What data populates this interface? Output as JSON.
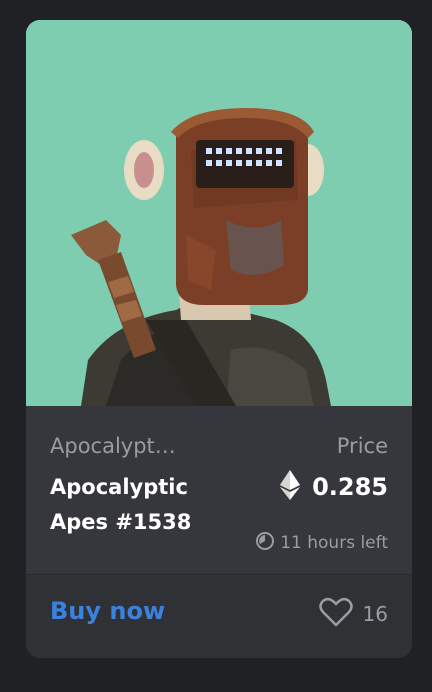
{
  "card": {
    "image_subject": "nft-artwork",
    "collection_name": "Apocalypt…",
    "nft_name": "Apocalyptic Apes #1538",
    "price_label": "Price",
    "price_value": "0.285",
    "currency_icon": "ethereum-icon",
    "time_icon": "clock-icon",
    "time_left": "11 hours left",
    "buy_label": "Buy now",
    "like_icon": "heart-icon",
    "likes_count": "16"
  },
  "colors": {
    "page_background": "#202124",
    "card_background": "#35373c",
    "art_background": "#7fcdb0",
    "accent_blue": "#3b82e0",
    "muted_text": "#9a9ca1"
  }
}
